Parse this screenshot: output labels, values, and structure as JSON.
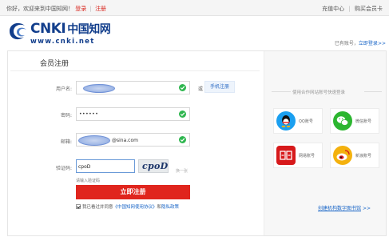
{
  "topbar": {
    "greeting": "你好，欢迎来到中国知网！",
    "login": "登录",
    "separator": "|",
    "register": "注册",
    "right_links": [
      "充值中心",
      "购买会员卡"
    ]
  },
  "logo": {
    "main": "CNKI",
    "chinese": "中国知网",
    "url": "www.cnki.net"
  },
  "account": {
    "prefix": "已有账号，",
    "link": "立即登录",
    "arrow": ">>"
  },
  "form": {
    "title": "会员注册",
    "username": {
      "label": "用户名:",
      "value": ""
    },
    "or_text": "或",
    "phone_register": "手机注册",
    "password": {
      "label": "密码:",
      "value": "••••••"
    },
    "email": {
      "label": "邮箱:",
      "value": "@sina.com"
    },
    "captcha": {
      "label": "验证码:",
      "value": "cpoD",
      "image_text": "cpoD",
      "refresh": "换一张",
      "hint": "请输入验证码"
    },
    "submit": "立即注册",
    "agree": {
      "text": "我已看过并同意",
      "link": "《中国知网使用协议》",
      "and": "和",
      "link2": "隐私政策"
    }
  },
  "third_party": {
    "title": "使用合作网站账号快速登录",
    "items": [
      {
        "label": "QQ账号",
        "icon": "qq-icon",
        "color": "#1a9ff0"
      },
      {
        "label": "微信账号",
        "icon": "wechat-icon",
        "color": "#2cb630"
      },
      {
        "label": "网易账号",
        "icon": "netease-icon",
        "color": "#d7191b"
      },
      {
        "label": "新浪账号",
        "icon": "weibo-icon",
        "color": "#f4b10d"
      }
    ]
  },
  "digital_link": {
    "text": "创建机构数字图书馆",
    "arrow": ">>"
  },
  "colors": {
    "brand_red": "#e0251d",
    "link_blue": "#1a66c7",
    "logo_blue": "#123e8c",
    "check_green": "#2fb64f"
  }
}
